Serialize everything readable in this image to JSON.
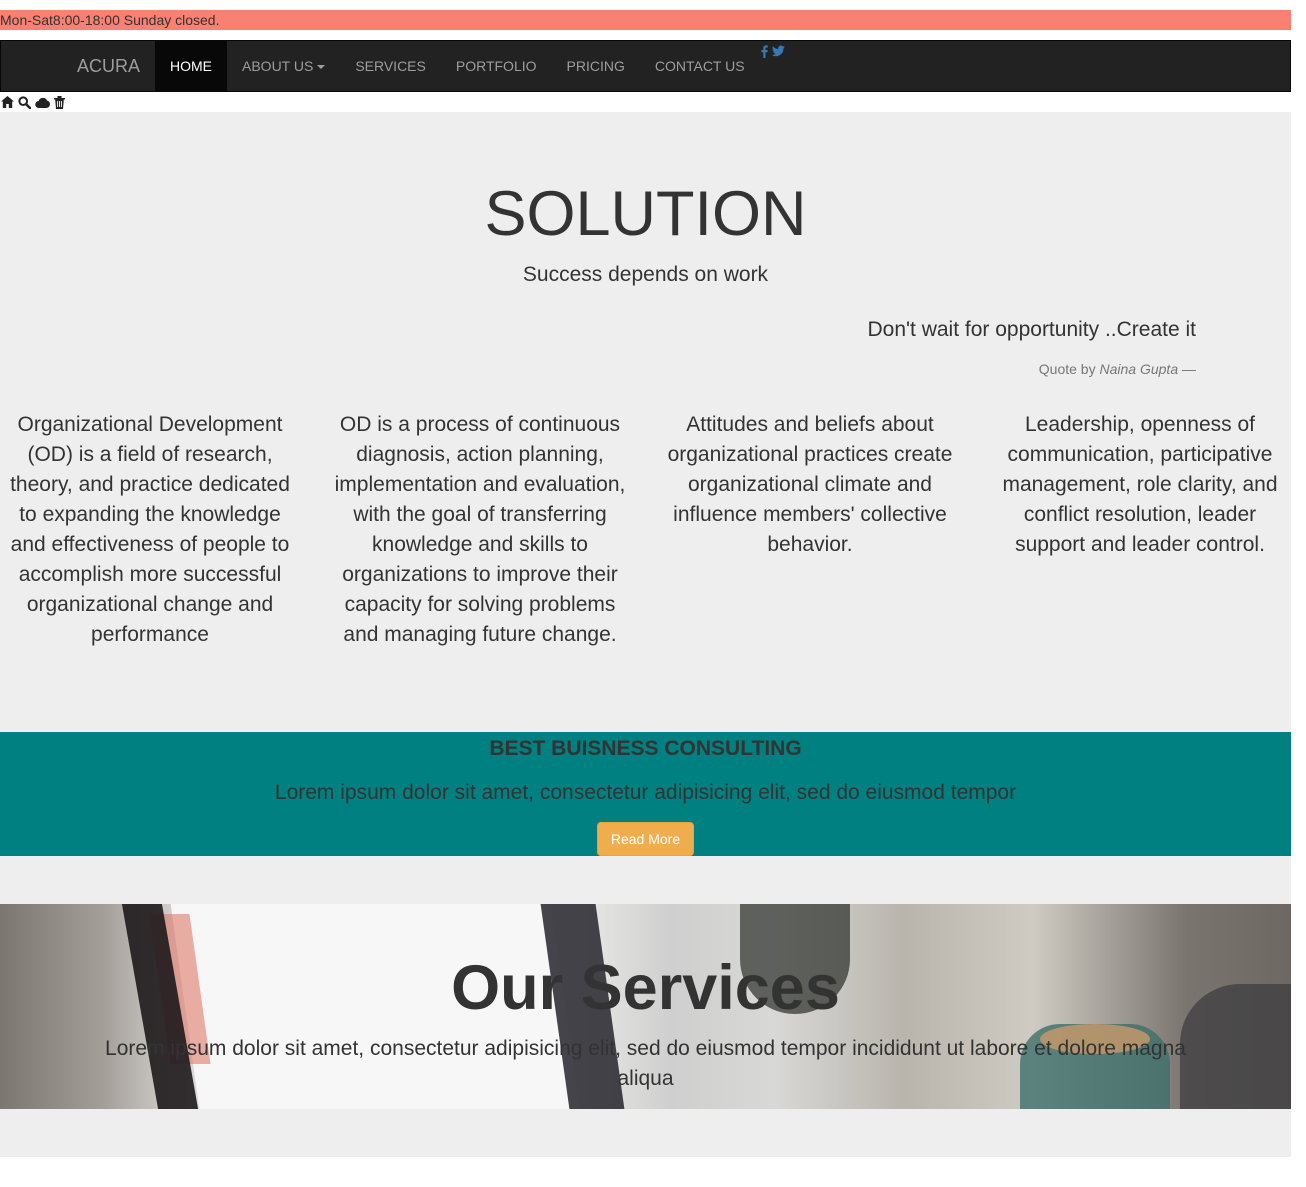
{
  "topbar": {
    "hours": "Mon-Sat8:00-18:00 Sunday closed."
  },
  "navbar": {
    "brand": "ACURA",
    "items": [
      {
        "label": "HOME",
        "active": true
      },
      {
        "label": "ABOUT US",
        "dropdown": true
      },
      {
        "label": "SERVICES"
      },
      {
        "label": "PORTFOLIO"
      },
      {
        "label": "PRICING"
      },
      {
        "label": "CONTACT US"
      }
    ],
    "social_icons": [
      "facebook-icon",
      "twitter-icon"
    ],
    "social_color": "#337ab7"
  },
  "icon_row": [
    "home-icon",
    "search-icon",
    "cloud-icon",
    "trash-icon"
  ],
  "solution": {
    "title": "SOLUTION",
    "subtitle": "Success depends on work",
    "quote": "Don't wait for opportunity ..Create it",
    "quote_prefix": "Quote by",
    "quote_author": "Naina Gupta",
    "quote_suffix": "—",
    "columns": [
      "Organizational Development (OD) is a field of research, theory, and practice dedicated to expanding the knowledge and effectiveness of people to accomplish more successful organizational change and performance",
      "OD is a process of continuous diagnosis, action planning, implementation and evaluation, with the goal of transferring knowledge and skills to organizations to improve their capacity for solving problems and managing future change.",
      "Attitudes and beliefs about organizational practices create organizational climate and influence members' collective behavior.",
      "Leadership, openness of communication, participative management, role clarity, and conflict resolution, leader support and leader control."
    ]
  },
  "banner": {
    "title": "BEST BUISNESS CONSULTING",
    "text": "Lorem ipsum dolor sit amet, consectetur adipisicing elit, sed do eiusmod tempor",
    "button": "Read More",
    "background": "#008080",
    "button_color": "#f0ad4e"
  },
  "services": {
    "title": "Our Services",
    "text": "Lorem ipsum dolor sit amet, consectetur adipisicing elit, sed do eiusmod tempor incididunt ut labore et dolore magna aliqua"
  },
  "colors": {
    "topbar": "#fa8072",
    "navbar": "#222222",
    "section_bg": "#eeeeee"
  }
}
